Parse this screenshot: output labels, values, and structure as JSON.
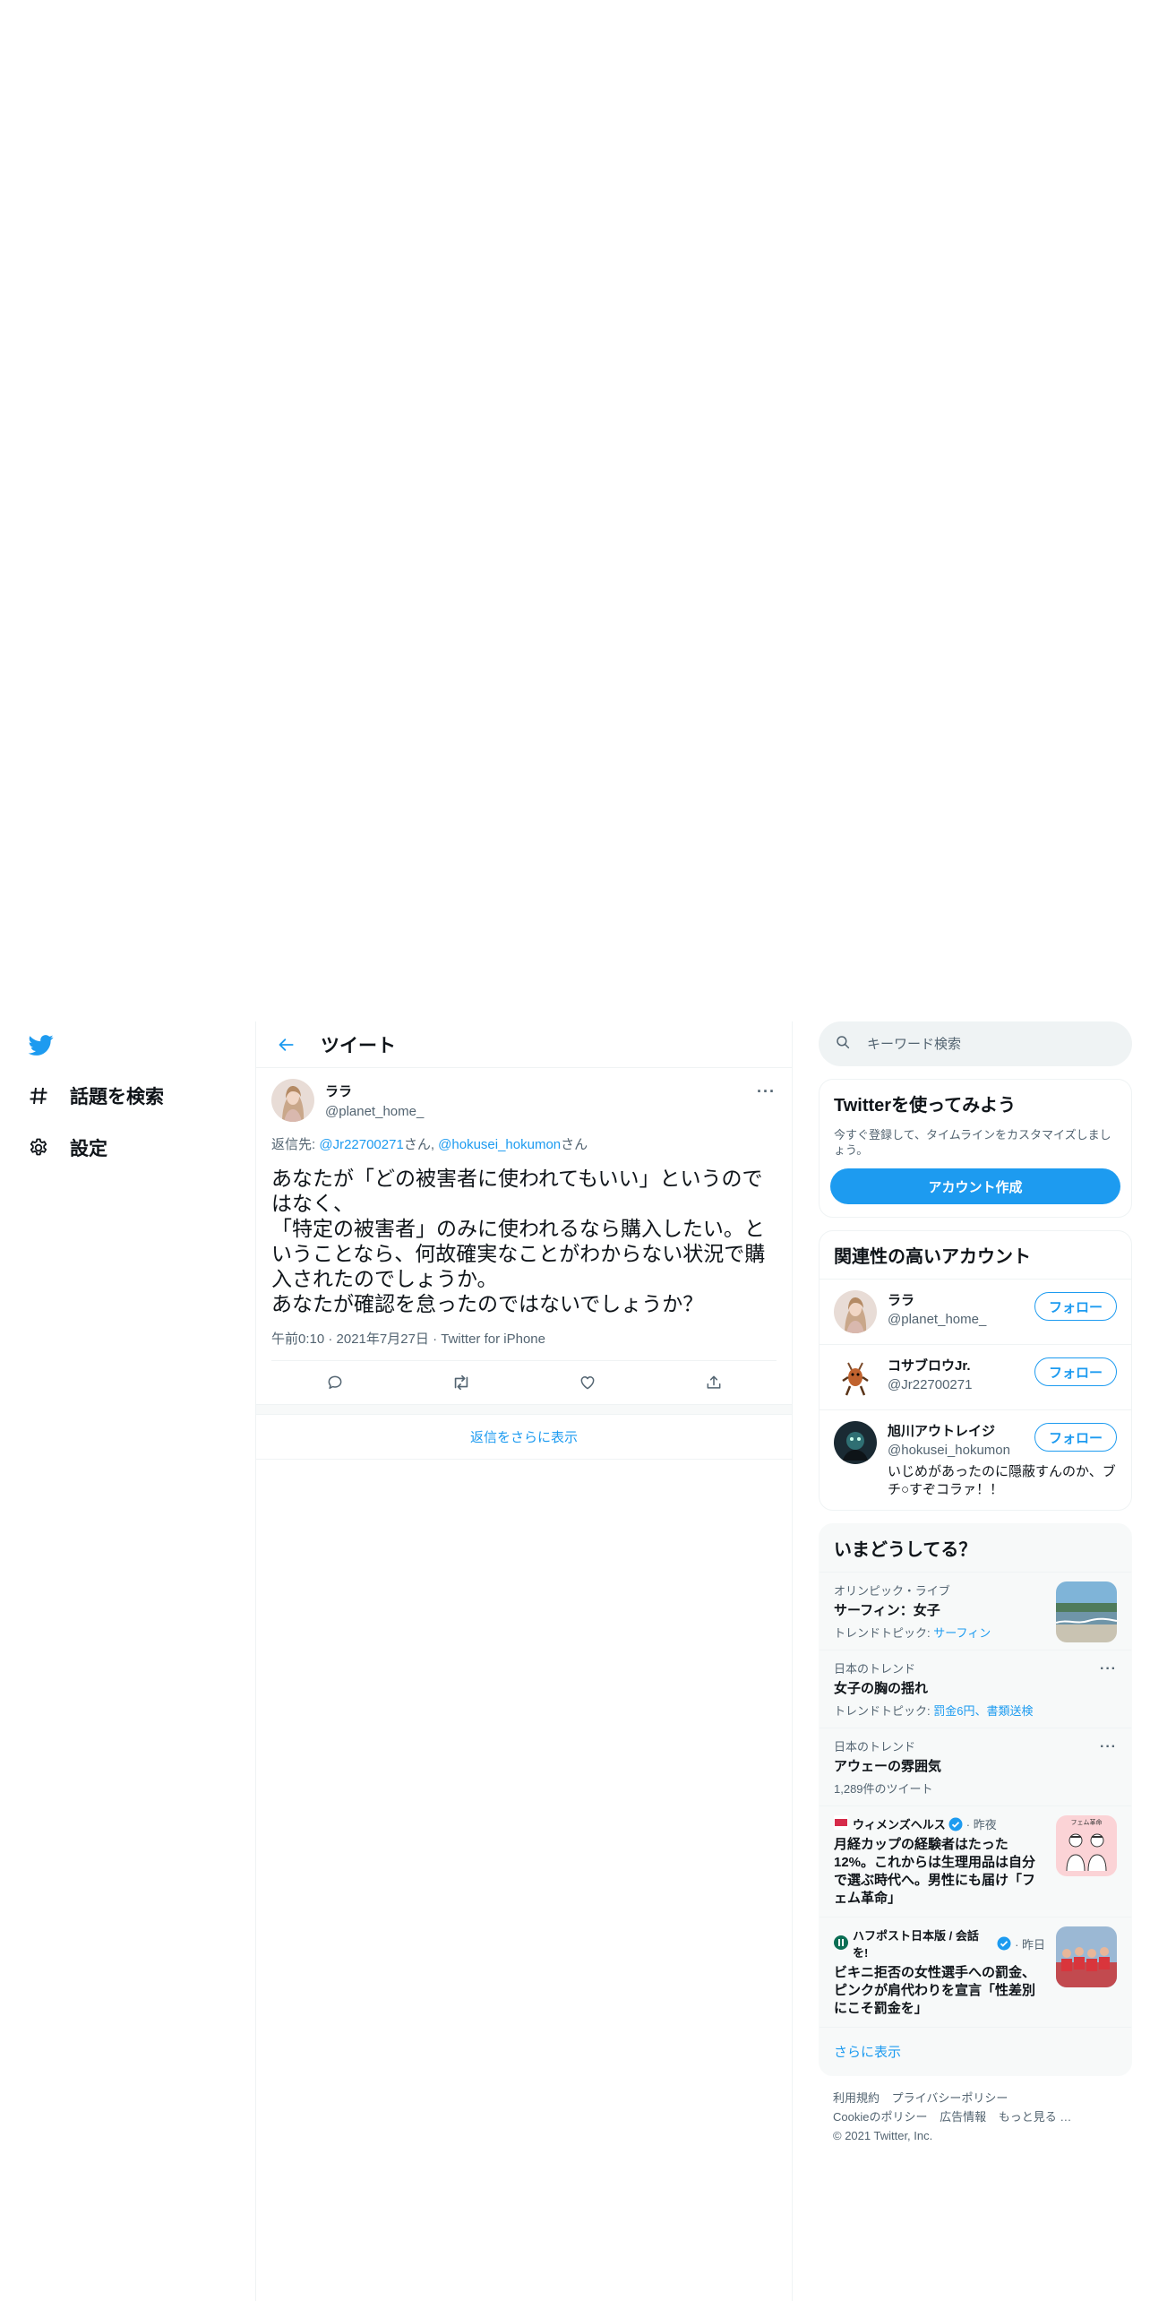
{
  "colors": {
    "accent": "#1d9bf0",
    "text": "#0f1419",
    "muted": "#536471"
  },
  "nav": {
    "logo_icon": "twitter-bird-icon",
    "items": [
      {
        "label": "話題を検索",
        "icon": "hashtag-icon"
      },
      {
        "label": "設定",
        "icon": "gear-icon"
      }
    ]
  },
  "header": {
    "title": "ツイート"
  },
  "tweet": {
    "author_name": "ララ",
    "author_handle": "@planet_home_",
    "reply_prefix": "返信先: ",
    "reply_user1": "@Jr22700271",
    "reply_mid": "さん, ",
    "reply_user2": "@hokusei_hokumon",
    "reply_suffix": "さん",
    "body": "あなたが「どの被害者に使われてもいい」というのではなく、\n「特定の被害者」のみに使われるなら購入したい。ということなら、何故確実なことがわからない状況で購入されたのでしょうか。\nあなたが確認を怠ったのではないでしょうか？",
    "meta": "午前0:10 · 2021年7月27日 · Twitter for iPhone",
    "actions": [
      "reply-icon",
      "retweet-icon",
      "like-icon",
      "share-icon"
    ]
  },
  "show_more_replies": "返信をさらに表示",
  "search": {
    "placeholder": "キーワード検索"
  },
  "signup": {
    "title": "Twitterを使ってみよう",
    "desc": "今すぐ登録して、タイムラインをカスタマイズしましょう。",
    "button": "アカウント作成"
  },
  "related": {
    "title": "関連性の高いアカウント",
    "follow_label": "フォロー",
    "accounts": [
      {
        "name": "ララ",
        "handle": "@planet_home_",
        "bio": ""
      },
      {
        "name": "コサブロウJr.",
        "handle": "@Jr22700271",
        "bio": ""
      },
      {
        "name": "旭川アウトレイジ",
        "handle": "@hokusei_hokumon",
        "bio": "いじめがあったのに隠蔽すんのか、ブチ○すぞコラァ！！"
      }
    ]
  },
  "trends": {
    "title": "いまどうしてる？",
    "items": [
      {
        "context": "オリンピック・ライブ",
        "title": "サーフィン：女子",
        "sub_prefix": "トレンドトピック: ",
        "sub_link": "サーフィン"
      },
      {
        "context": "日本のトレンド",
        "title": "女子の胸の揺れ",
        "sub_prefix": "トレンドトピック: ",
        "sub_link": "罰金6円、書類送検"
      },
      {
        "context": "日本のトレンド",
        "title": "アウェーの雰囲気",
        "sub_prefix": "1,289件のツイート",
        "sub_link": ""
      }
    ],
    "news": [
      {
        "source": "ウィメンズヘルス",
        "time": "· 昨夜",
        "title": "月経カップの経験者はたった12%。これからは生理用品は自分で選ぶ時代へ。男性にも届け「フェム革命」",
        "thumb_text": "フェム革命"
      },
      {
        "source": "ハフポスト日本版 / 会話を!",
        "time": "· 昨日",
        "title": "ビキニ拒否の女性選手への罰金、ピンクが肩代わりを宣言「性差別にこそ罰金を」",
        "thumb_text": ""
      }
    ],
    "see_more": "さらに表示"
  },
  "footer": {
    "links": [
      "利用規約",
      "プライバシーポリシー",
      "Cookieのポリシー",
      "広告情報",
      "もっと見る …"
    ],
    "copyright": "© 2021 Twitter, Inc."
  }
}
